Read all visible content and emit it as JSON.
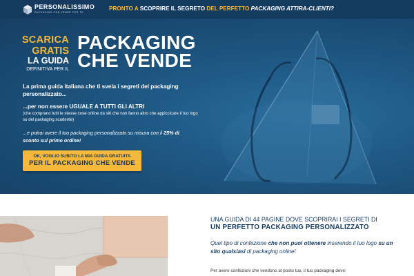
{
  "topbar": {
    "logo_name": "PERSONALISSIMO",
    "logo_tagline": "PACKAGING CHE VENDE PER TE",
    "headline_part1": "PRONTO A ",
    "headline_part2": "SCOPRIRE IL SEGRETO",
    "headline_part3": " DEL PERFETTO ",
    "headline_part4": "PACKAGING ATTIRA-CLIENTI?"
  },
  "hero": {
    "scarica": "SCARICA",
    "gratis": "GRATIS",
    "la_guida": "LA GUIDA",
    "definitiva": "DEFINITIVA PER IL",
    "title_line1": "PACKAGING",
    "title_line2": "CHE VENDE",
    "intro": "La prima guida italiana che ti svela i segreti del packaging personalizzato...",
    "intro2": "...per non essere UGUALE A TUTTI GLI ALTRI",
    "intro2_note": "(che comprano tutti le stesse cose online da siti che non fanno altro che appiccicare il tuo logo su del packaging scadente)",
    "intro3_part1": "...e potrai avere il tuo packaging personalizzato su misura con il ",
    "intro3_part2": "25% di sconto sul primo ordine!",
    "cta_line1": "OK, VOGLIO SUBITO LA MIA GUIDA GRATUITA",
    "cta_line2": "PER IL PACKAGING CHE VENDE"
  },
  "lower": {
    "subtitle_line1": "UNA GUIDA DI 44 PAGINE DOVE SCOPRIRAI I SEGRETI DI",
    "subtitle_line2": "UN PERFETTO PACKAGING PERSONALIZZATO",
    "question_part1": "Quel tipo di confezione ",
    "question_part2": "che non puoi ottenere",
    "question_part3": " inserendo il tuo logo ",
    "question_part4": "su un sito qualsiasi",
    "question_part5": " di packaging online!",
    "bottom_text": "Per avere confezioni che vendono al posto tuo, il tuo packaging deve:"
  },
  "colors": {
    "navy": "#143a5f",
    "hero_blue": "#1f5a86",
    "accent_yellow": "#f4b93b"
  },
  "icons": {
    "logo_mark": "cube-logo-icon"
  }
}
